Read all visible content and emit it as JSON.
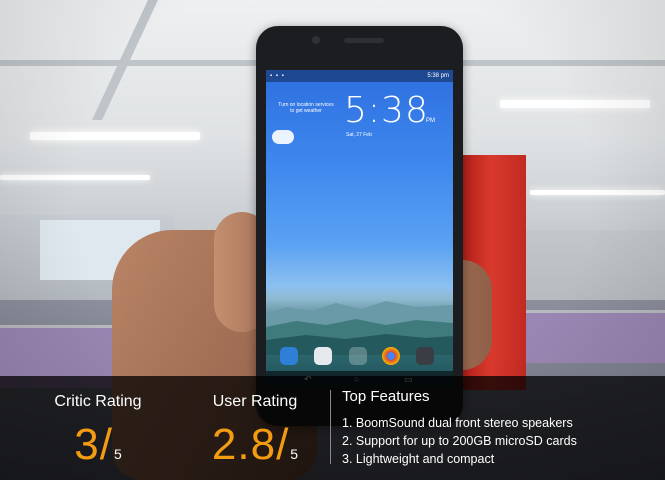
{
  "phone_screen": {
    "status_right": "5:38 pm",
    "weather_text": "Turn on location services to get weather",
    "time": "5:38",
    "ampm": "PM",
    "date": "Sat, 27 Feb",
    "nav_back": "↶",
    "nav_home": "○",
    "nav_recent": "▭"
  },
  "critic_rating": {
    "label": "Critic Rating",
    "score": "3",
    "slash": "/",
    "out_of": "5"
  },
  "user_rating": {
    "label": "User Rating",
    "score": "2.8",
    "slash": "/",
    "out_of": "5"
  },
  "top_features": {
    "title": "Top Features",
    "items": [
      "1. BoomSound dual front stereo speakers",
      "2. Support for up to 200GB microSD cards",
      "3. Lightweight and compact"
    ]
  },
  "colors": {
    "accent": "#f39c12",
    "overlay": "#000000"
  },
  "icons": [
    "phone-app-icon",
    "messages-app-icon",
    "apps-grid-icon",
    "chrome-app-icon",
    "camera-app-icon"
  ]
}
